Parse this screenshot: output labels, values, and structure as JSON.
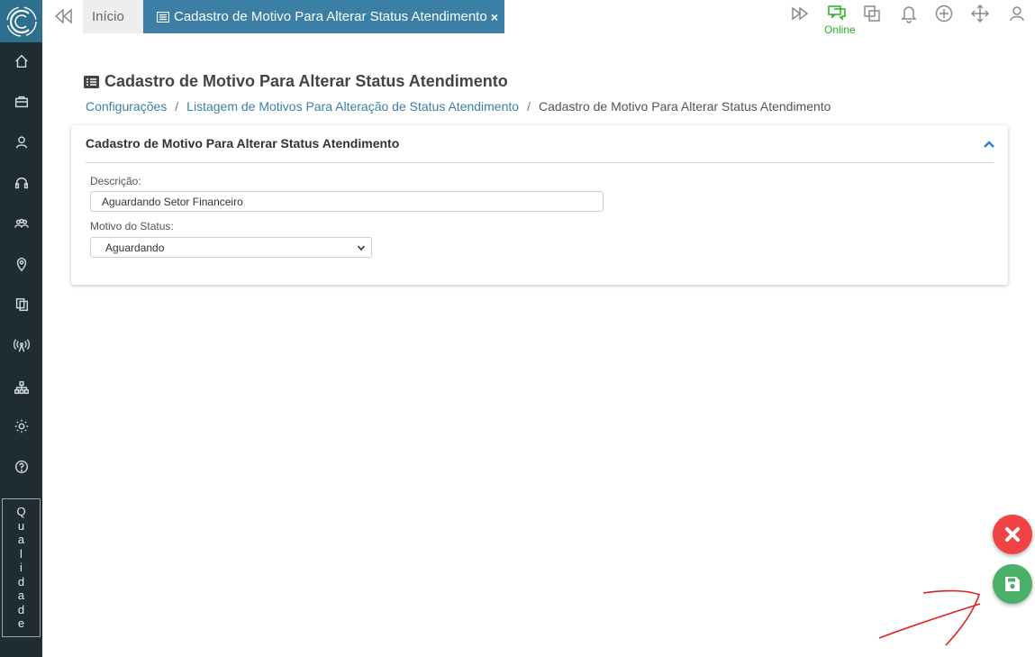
{
  "topbar": {
    "home_tab": "Início",
    "active_tab": "Cadastro de Motivo Para Alterar Status Atendimento",
    "close_symbol": "×",
    "status_label": "Online",
    "icons": [
      "fast-forward-icon",
      "chat-online-icon",
      "windows-icon",
      "bell-icon",
      "plus-circle-icon",
      "move-icon",
      "user-icon"
    ]
  },
  "sidebar": {
    "items": [
      "home-icon",
      "briefcase-icon",
      "user-icon",
      "headset-icon",
      "team-icon",
      "map-pin-icon",
      "copy-icon",
      "antenna-icon",
      "hierarchy-icon",
      "settings-icon",
      "help-icon"
    ],
    "quality_letters": [
      "Q",
      "u",
      "a",
      "l",
      "i",
      "d",
      "a",
      "d",
      "e"
    ]
  },
  "page": {
    "title": "Cadastro de Motivo Para Alterar Status Atendimento",
    "breadcrumb": {
      "item1": "Configurações",
      "item2": "Listagem de Motivos Para Alteração de Status Atendimento",
      "current": "Cadastro de Motivo Para Alterar Status Atendimento",
      "separator": "/"
    }
  },
  "form": {
    "header": "Cadastro de Motivo Para Alterar Status Atendimento",
    "descricao_label": "Descrição:",
    "descricao_value": "Aguardando Setor Financeiro",
    "motivo_label": "Motivo do Status:",
    "motivo_value": "Aguardando"
  },
  "colors": {
    "sidebar": "#1f2d33",
    "accent": "#3c7fa6",
    "online": "#22b022",
    "cancel": "#f04444",
    "save": "#4caf68"
  }
}
